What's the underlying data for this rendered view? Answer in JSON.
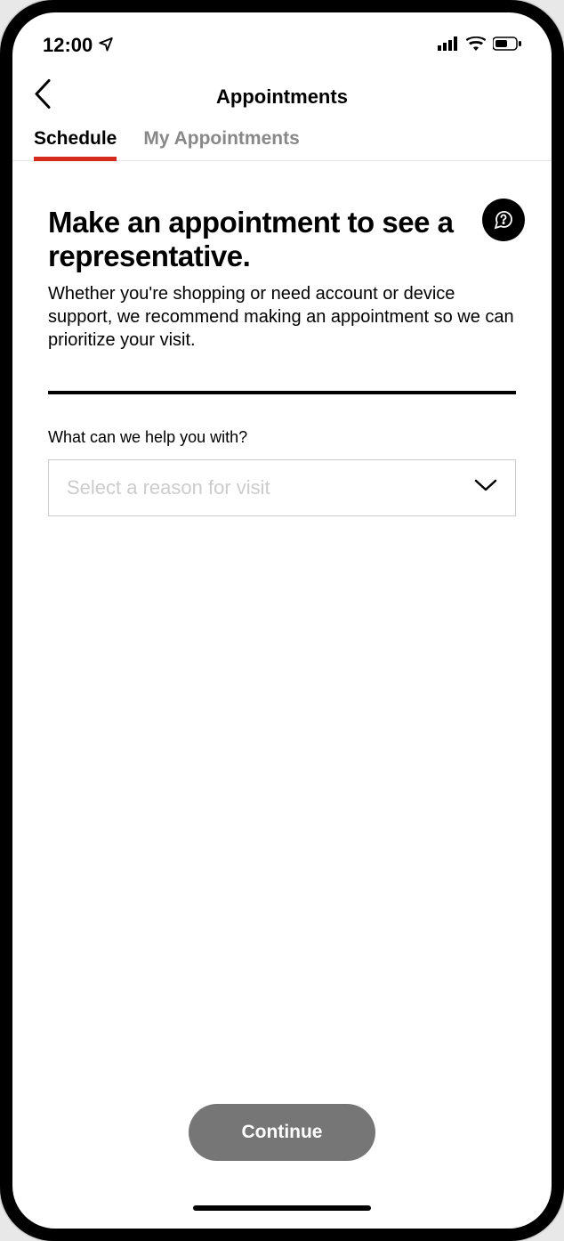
{
  "status": {
    "time": "12:00"
  },
  "nav": {
    "title": "Appointments"
  },
  "tabs": {
    "schedule": "Schedule",
    "my_appointments": "My Appointments"
  },
  "main": {
    "heading": "Make an appointment to see a representative.",
    "subheading": "Whether you're shopping or need account or device support, we recommend making an appointment so we can prioritize your visit.",
    "field_label": "What can we help you with?",
    "select_placeholder": "Select a reason for visit"
  },
  "footer": {
    "continue": "Continue"
  }
}
